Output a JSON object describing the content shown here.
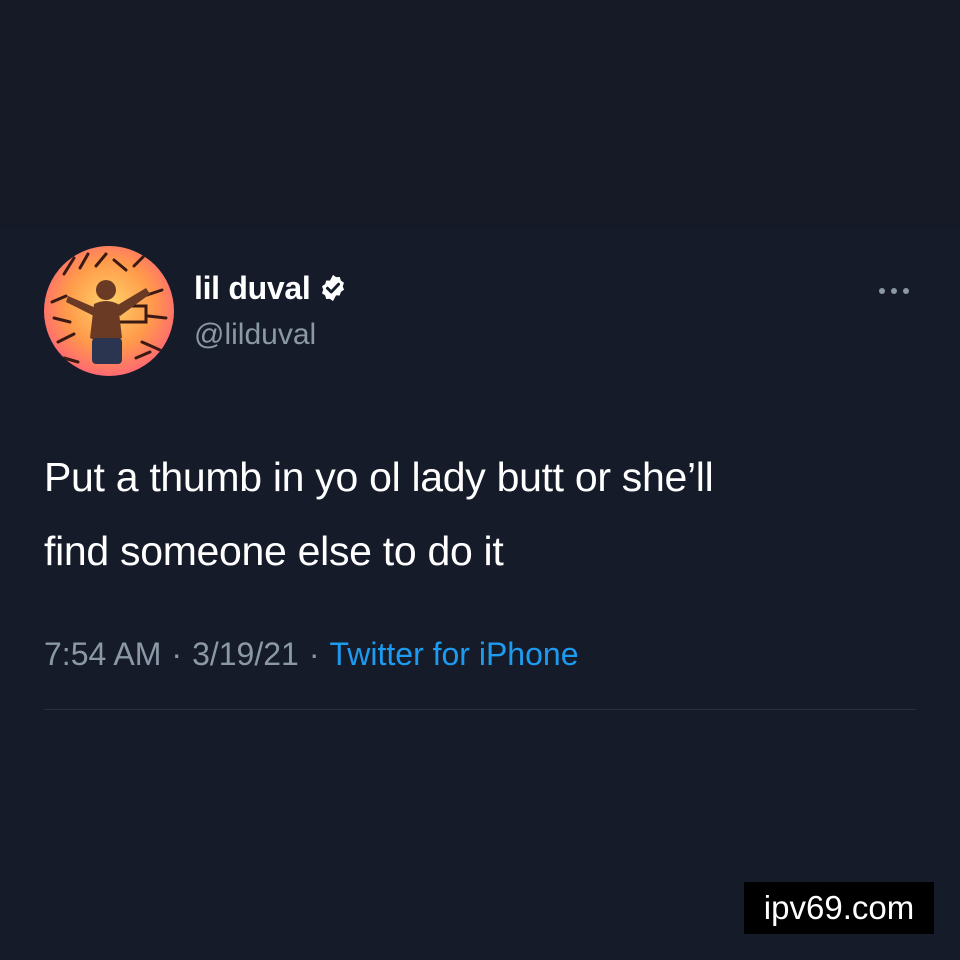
{
  "tweet": {
    "display_name": "lil duval",
    "handle": "@lilduval",
    "verified": true,
    "text_line1": "Put a thumb in yo ol lady butt or she’ll",
    "text_line2": "find someone else to do it",
    "time": "7:54 AM",
    "separator": "·",
    "date": "3/19/21",
    "source": "Twitter for iPhone",
    "icons": {
      "verified": "verified-badge-icon",
      "more": "more-options-icon"
    }
  },
  "watermark": {
    "text": "ipv69.com"
  },
  "colors": {
    "background": "#151b29",
    "text_primary": "#ffffff",
    "text_secondary": "#8b98a5",
    "link": "#1d9bf0",
    "watermark_bg": "#000000"
  }
}
